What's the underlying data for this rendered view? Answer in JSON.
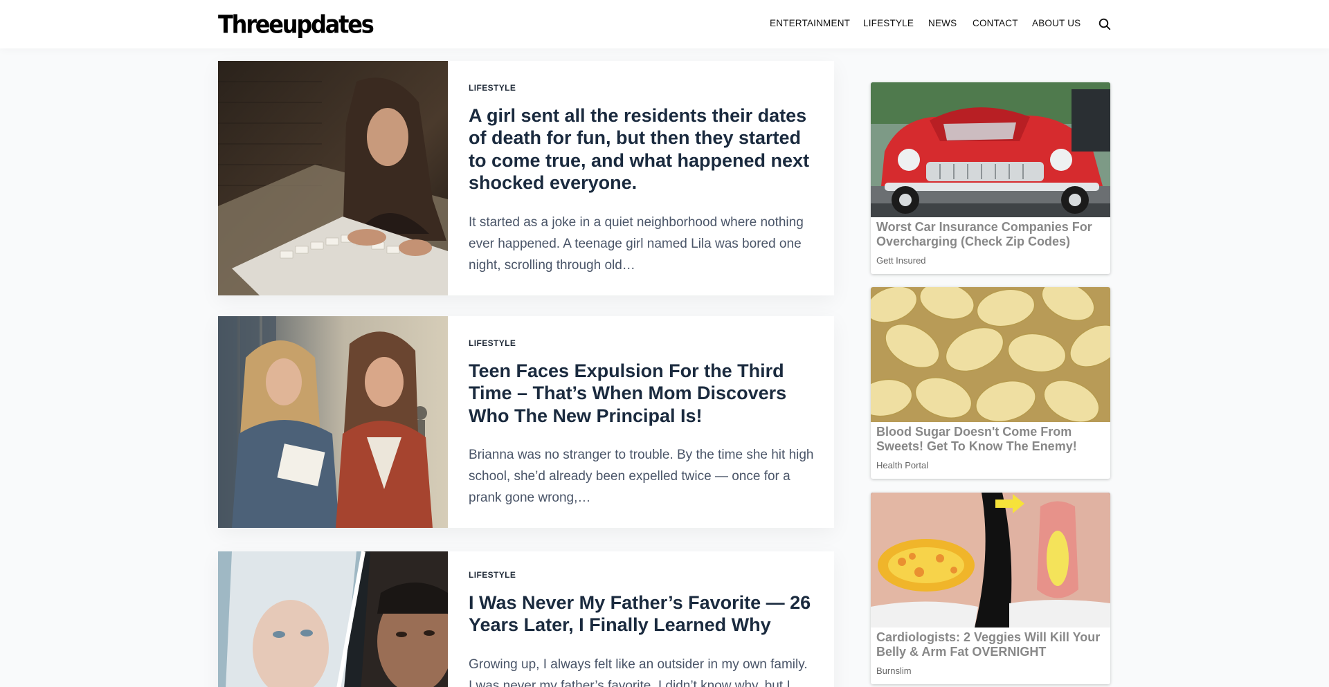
{
  "site": {
    "logo": "Threeupdates"
  },
  "nav": {
    "items": [
      {
        "label": "ENTERTAINMENT"
      },
      {
        "label": "LIFESTYLE"
      },
      {
        "label": "NEWS"
      },
      {
        "label": "CONTACT"
      },
      {
        "label": "ABOUT US"
      }
    ],
    "search_icon": "search-icon"
  },
  "articles": [
    {
      "category": "LIFESTYLE",
      "title": "A girl sent all the residents their dates of death for fun, but then they started to come true, and what happened next shocked everyone.",
      "excerpt": "It started as a joke in a quiet neighborhood where nothing ever happened. A teenage girl named Lila was bored one night, scrolling through old…"
    },
    {
      "category": "LIFESTYLE",
      "title": "Teen Faces Expulsion For the Third Time – That’s When Mom Discovers Who The New Principal Is!",
      "excerpt": "Brianna was no stranger to trouble. By the time she hit high school, she’d already been expelled twice — once for a prank gone wrong,…"
    },
    {
      "category": "LIFESTYLE",
      "title": "I Was Never My Father’s Favorite — 26 Years Later, I Finally Learned Why",
      "excerpt": "Growing up, I always felt like an outsider in my own family. I was never my father’s favorite. I didn’t know why, but I…"
    }
  ],
  "sidebar_ads": [
    {
      "title": "Worst Car Insurance Companies For Overcharging (Check Zip Codes)",
      "source": "Gett Insured"
    },
    {
      "title": "Blood Sugar Doesn't Come From Sweets! Get To Know The Enemy!",
      "source": "Health Portal"
    },
    {
      "title": "Cardiologists: 2 Veggies Will Kill Your Belly & Arm Fat OVERNIGHT",
      "source": "Burnslim"
    }
  ],
  "colors": {
    "page_background": "#f9fafb",
    "title": "#1a2a3e",
    "excerpt": "#4a5568",
    "ad_title": "#888888"
  }
}
